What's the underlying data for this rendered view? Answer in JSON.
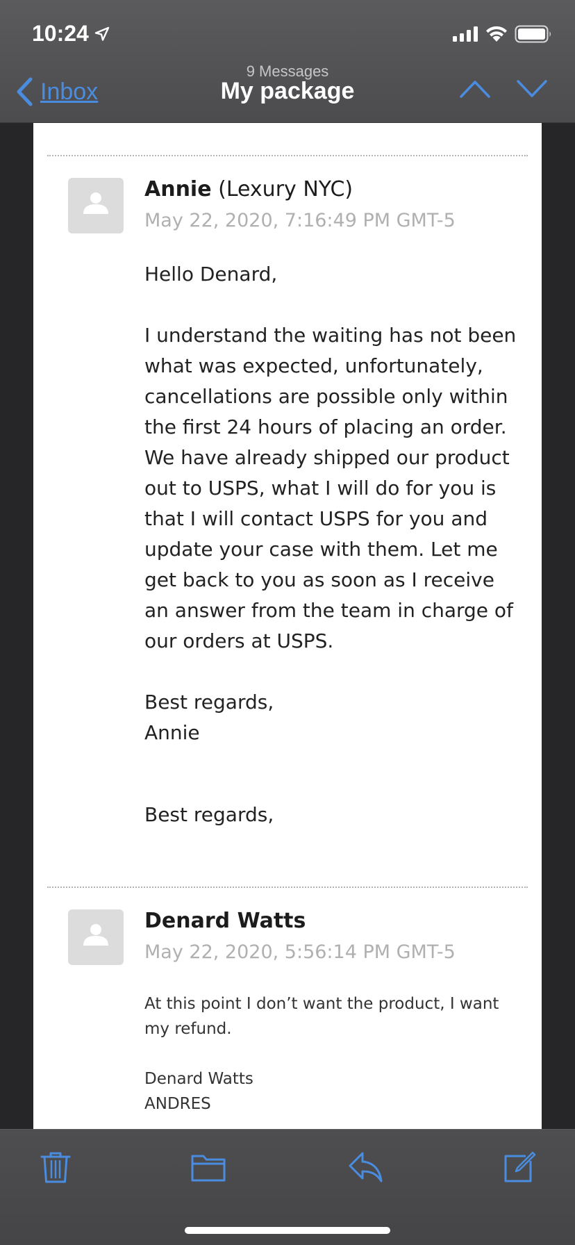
{
  "status_bar": {
    "time": "10:24",
    "icons": [
      "location-arrow-icon",
      "cellular-signal-icon",
      "wifi-icon",
      "battery-icon"
    ]
  },
  "nav": {
    "back_label": "Inbox",
    "subtitle": "9 Messages",
    "title": "My package",
    "icons": [
      "chevron-left-icon",
      "chevron-up-icon",
      "chevron-down-icon"
    ]
  },
  "messages": [
    {
      "sender_name": "Annie",
      "sender_org": "(Lexury NYC)",
      "date": "May 22, 2020, 7:16:49 PM GMT-5",
      "greeting": "Hello Denard,",
      "paragraph_lines": [
        "I understand the waiting has not been",
        "what was expected, unfortunately,",
        "cancellations are possible only within",
        "the first 24 hours of placing an order.",
        "We have already shipped our product",
        "out to USPS, what I will do for you is",
        "that I will contact USPS for you and",
        "update your case with them. Let me",
        "get back to you as soon as I receive",
        "an answer from the team in charge of",
        "our orders at USPS."
      ],
      "signoff": "Best regards,",
      "signature": "Annie",
      "signoff_repeat": "Best regards,"
    },
    {
      "sender_name": "Denard Watts",
      "date": "May 22, 2020, 5:56:14 PM GMT-5",
      "body_lines": [
        "At this point I don’t want the product, I want",
        "my refund."
      ],
      "signature_lines": [
        "Denard Watts",
        "ANDRES"
      ]
    }
  ],
  "toolbar": {
    "icons": [
      "trash-icon",
      "folder-icon",
      "reply-icon",
      "compose-icon"
    ]
  },
  "colors": {
    "accent": "#4a8de0",
    "bar_background": "#555557",
    "side_background": "#262628",
    "sheet": "#ffffff",
    "date_text": "#b0b0b0"
  }
}
